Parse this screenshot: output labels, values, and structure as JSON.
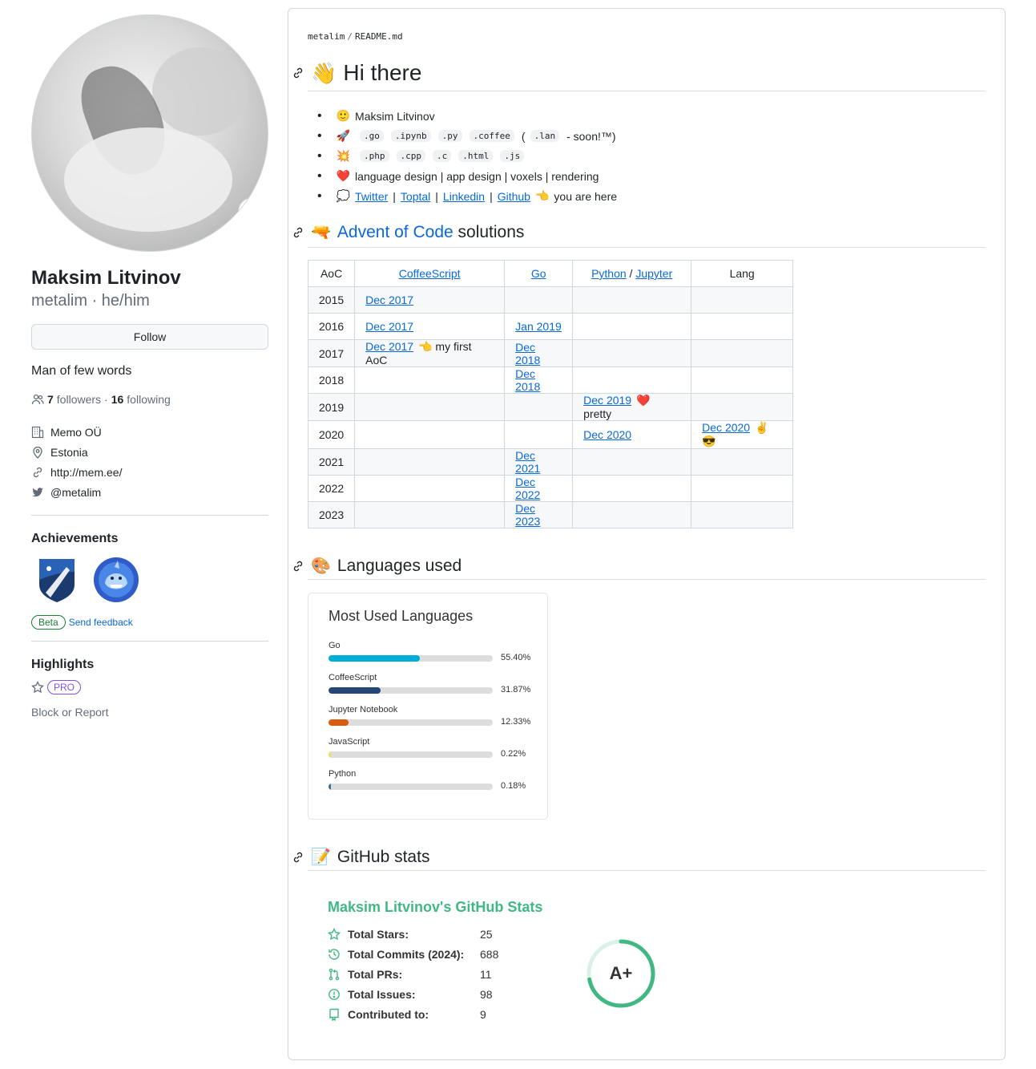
{
  "profile": {
    "full_name": "Maksim Litvinov",
    "login": "metalim",
    "pronouns": "he/him",
    "follow_label": "Follow",
    "bio": "Man of few words",
    "followers_count": "7",
    "followers_label": "followers",
    "following_count": "16",
    "following_label": "following",
    "company": "Memo OÜ",
    "location": "Estonia",
    "website": "http://mem.ee/",
    "twitter": "@metalim",
    "status_emoji": "🎯"
  },
  "achievements": {
    "title": "Achievements",
    "beta_label": "Beta",
    "feedback_label": "Send feedback"
  },
  "highlights": {
    "title": "Highlights",
    "pro_label": "PRO",
    "block_label": "Block or Report"
  },
  "readme": {
    "path_owner": "metalim",
    "path_file": "README.md",
    "heading_hi": "Hi there",
    "hi_emoji": "👋",
    "list": {
      "name": "Maksim Litvinov",
      "name_emoji": "🙂",
      "langs1": [
        ".go",
        ".ipynb",
        ".py",
        ".coffee"
      ],
      "langs1_paren": "(",
      "langs1_soon_code": ".lan",
      "langs1_soon": "- soon!™)",
      "langs1_emoji": "🚀",
      "langs2": [
        ".php",
        ".cpp",
        ".c",
        ".html",
        ".js"
      ],
      "langs2_emoji": "💥",
      "interests": "language design | app design | voxels | rendering",
      "interests_emoji": "❤️",
      "links": [
        "Twitter",
        "Toptal",
        "Linkedin",
        "Github"
      ],
      "links_sep": "|",
      "links_emoji": "💭",
      "here_emoji": "👈",
      "here_text": "you are here"
    },
    "aoc_heading_link": "Advent of Code",
    "aoc_heading_rest": "solutions",
    "aoc_emoji": "🔫",
    "aoc_table": {
      "headers": [
        "AoC",
        "CoffeeScript",
        "Go",
        "Python",
        "/",
        "Jupyter",
        "Lang"
      ],
      "rows": [
        {
          "year": "2015",
          "coffee": "Dec 2017",
          "coffee_note": "",
          "go": "",
          "python": "",
          "python_note": "",
          "lang": ""
        },
        {
          "year": "2016",
          "coffee": "Dec 2017",
          "coffee_note": "",
          "go": "Jan 2019",
          "python": "",
          "python_note": "",
          "lang": ""
        },
        {
          "year": "2017",
          "coffee": "Dec 2017",
          "coffee_note": "👈 my first AoC",
          "go": "Dec 2018",
          "python": "",
          "python_note": "",
          "lang": ""
        },
        {
          "year": "2018",
          "coffee": "",
          "coffee_note": "",
          "go": "Dec 2018",
          "python": "",
          "python_note": "",
          "lang": ""
        },
        {
          "year": "2019",
          "coffee": "",
          "coffee_note": "",
          "go": "",
          "python": "Dec 2019",
          "python_note": "❤️ pretty",
          "lang": ""
        },
        {
          "year": "2020",
          "coffee": "",
          "coffee_note": "",
          "go": "",
          "python": "Dec 2020",
          "python_note": "",
          "lang": "Dec 2020",
          "lang_note": "✌️ 😎"
        },
        {
          "year": "2021",
          "coffee": "",
          "coffee_note": "",
          "go": "Dec 2021",
          "python": "",
          "python_note": "",
          "lang": ""
        },
        {
          "year": "2022",
          "coffee": "",
          "coffee_note": "",
          "go": "Dec 2022",
          "python": "",
          "python_note": "",
          "lang": ""
        },
        {
          "year": "2023",
          "coffee": "",
          "coffee_note": "",
          "go": "Dec 2023",
          "python": "",
          "python_note": "",
          "lang": ""
        }
      ]
    },
    "languages_heading": "Languages used",
    "languages_emoji": "🎨",
    "languages_card": {
      "title": "Most Used Languages",
      "items": [
        {
          "name": "Go",
          "percent": 55.4,
          "label": "55.40%",
          "color": "#00ADD8"
        },
        {
          "name": "CoffeeScript",
          "percent": 31.87,
          "label": "31.87%",
          "color": "#244776"
        },
        {
          "name": "Jupyter Notebook",
          "percent": 12.33,
          "label": "12.33%",
          "color": "#DA5B0B"
        },
        {
          "name": "JavaScript",
          "percent": 0.22,
          "label": "0.22%",
          "color": "#f1e05a"
        },
        {
          "name": "Python",
          "percent": 0.18,
          "label": "0.18%",
          "color": "#3572A5"
        }
      ]
    },
    "stats_heading": "GitHub stats",
    "stats_emoji": "📝",
    "stats_card": {
      "title": "Maksim Litvinov's GitHub Stats",
      "rows": [
        {
          "label": "Total Stars:",
          "value": "25",
          "icon": "star-icon"
        },
        {
          "label": "Total Commits (2024):",
          "value": "688",
          "icon": "history-icon"
        },
        {
          "label": "Total PRs:",
          "value": "11",
          "icon": "pull-request-icon"
        },
        {
          "label": "Total Issues:",
          "value": "98",
          "icon": "issue-icon"
        },
        {
          "label": "Contributed to:",
          "value": "9",
          "icon": "repo-icon"
        }
      ],
      "rank": "A+",
      "rank_progress": 0.72,
      "accent": "#41b883"
    }
  }
}
